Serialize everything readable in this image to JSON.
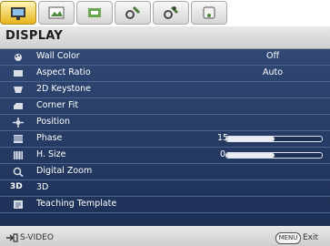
{
  "menu_title": "DISPLAY",
  "tabs": [
    {
      "icon": "display-tab-icon",
      "active": true
    },
    {
      "icon": "picture-tab-icon",
      "active": false
    },
    {
      "icon": "source-tab-icon",
      "active": false
    },
    {
      "icon": "system-setup-basic-tab-icon",
      "active": false
    },
    {
      "icon": "system-setup-advanced-tab-icon",
      "active": false
    },
    {
      "icon": "information-tab-icon",
      "active": false
    }
  ],
  "items": [
    {
      "label": "Wall Color",
      "value": "Off",
      "icon": "wall-color-icon"
    },
    {
      "label": "Aspect Ratio",
      "value": "Auto",
      "icon": "aspect-ratio-icon"
    },
    {
      "label": "2D Keystone",
      "icon": "keystone-icon"
    },
    {
      "label": "Corner Fit",
      "icon": "corner-fit-icon"
    },
    {
      "label": "Position",
      "icon": "position-icon"
    },
    {
      "label": "Phase",
      "number": "15",
      "level": 0.5,
      "icon": "phase-icon"
    },
    {
      "label": "H. Size",
      "number": "0",
      "level": 0.5,
      "icon": "h-size-icon"
    },
    {
      "label": "Digital Zoom",
      "icon": "digital-zoom-icon"
    },
    {
      "label": "3D",
      "icon_text": "3D",
      "icon": "3d-icon"
    },
    {
      "label": "Teaching Template",
      "icon": "teaching-template-icon"
    }
  ],
  "footer": {
    "source": "S-VIDEO",
    "menu_button": "MENU",
    "exit": "Exit"
  },
  "colors": {
    "menu_bg": "#2a4170",
    "active_tab": "#f0c020",
    "text": "#ffffff"
  }
}
